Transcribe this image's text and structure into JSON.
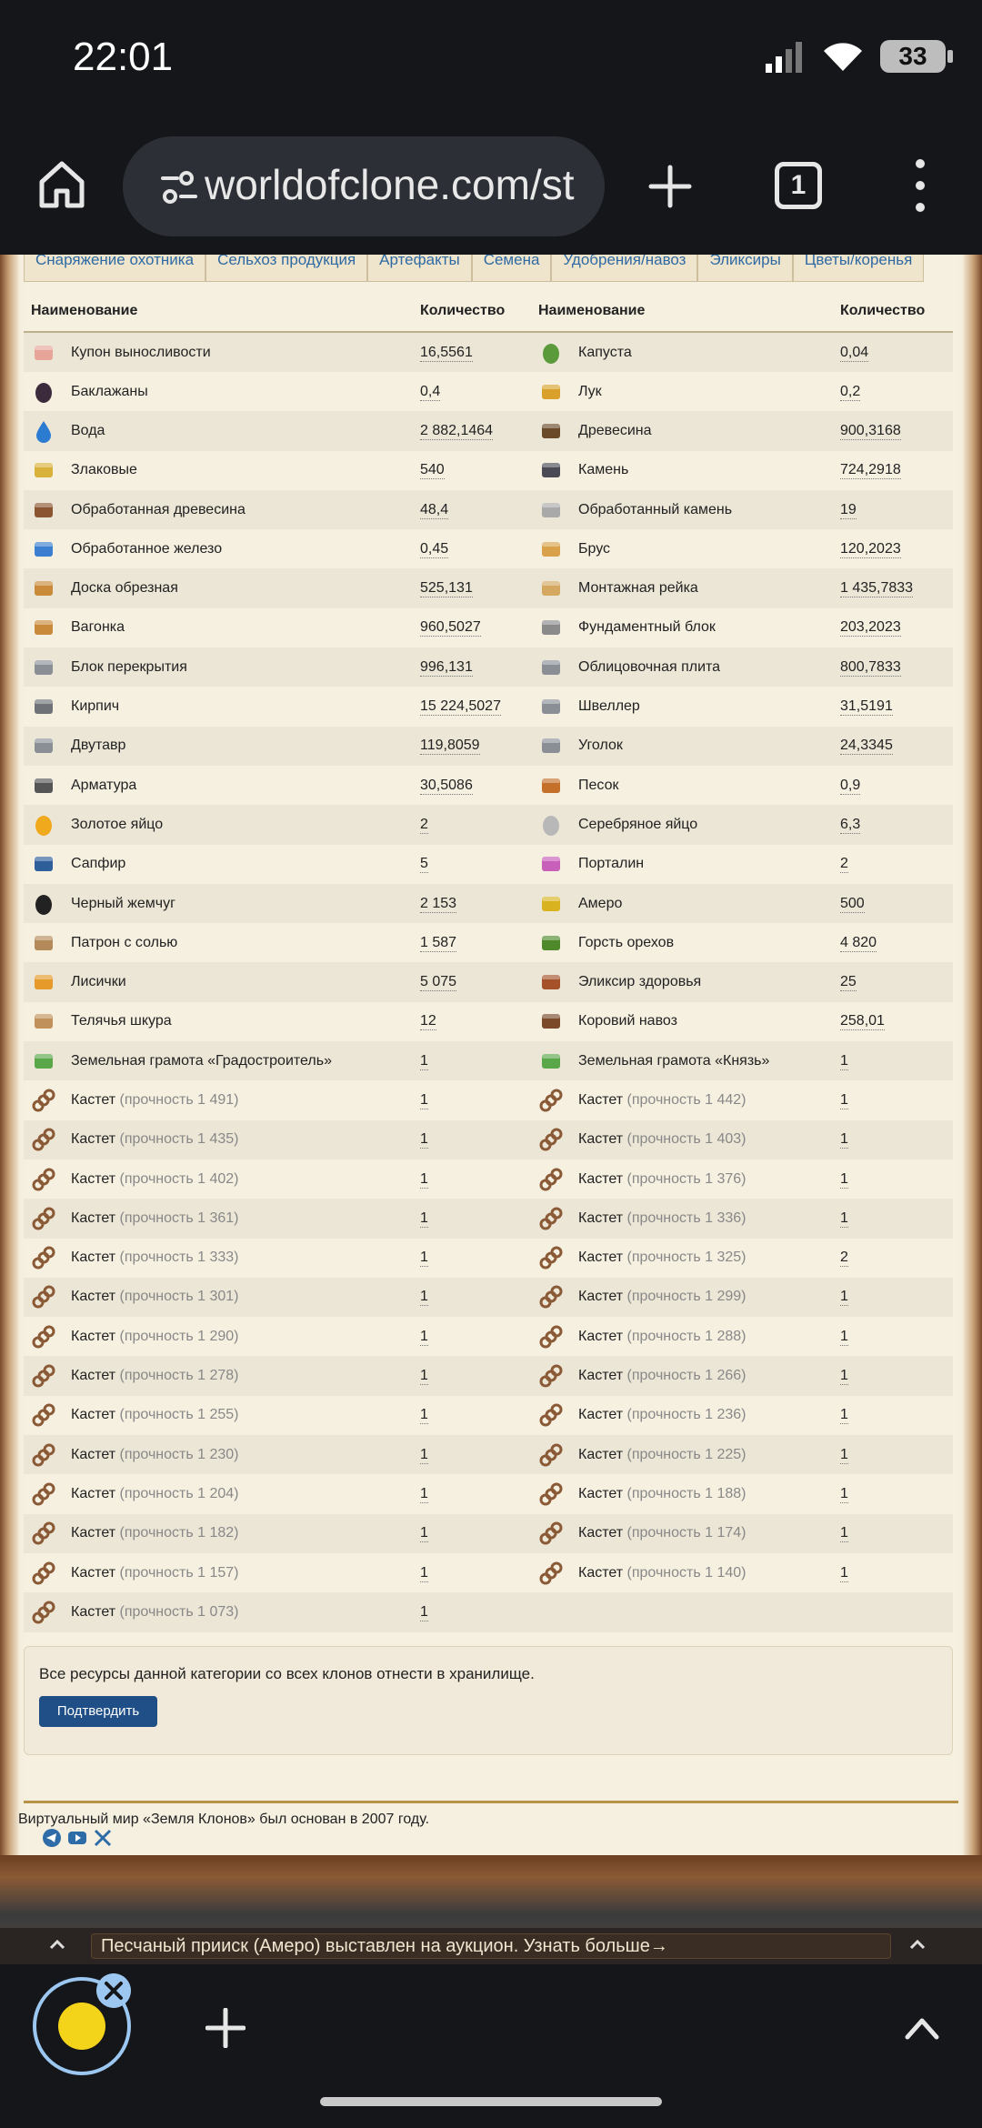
{
  "status": {
    "time": "22:01",
    "battery": "33"
  },
  "browser": {
    "url": "worldofclone.com/st",
    "tab_count": "1"
  },
  "subtabs": [
    "Снаряжение охотника",
    "Сельхоз продукция",
    "Артефакты",
    "Семена",
    "Удобрения/навоз",
    "Эликсиры",
    "Цветы/коренья"
  ],
  "table": {
    "headers": {
      "name": "Наименование",
      "qty": "Количество"
    },
    "rows": [
      {
        "l": {
          "icon": "coupon-icon",
          "name": "Купон выносливости",
          "qty": "16,5561"
        },
        "r": {
          "icon": "cabbage-icon",
          "name": "Капуста",
          "qty": "0,04"
        }
      },
      {
        "l": {
          "icon": "eggplant-icon",
          "name": "Баклажаны",
          "qty": "0,4"
        },
        "r": {
          "icon": "onion-icon",
          "name": "Лук",
          "qty": "0,2"
        }
      },
      {
        "l": {
          "icon": "water-drop-icon",
          "name": "Вода",
          "qty": "2 882,1464"
        },
        "r": {
          "icon": "wood-icon",
          "name": "Древесина",
          "qty": "900,3168"
        }
      },
      {
        "l": {
          "icon": "grain-icon",
          "name": "Злаковые",
          "qty": "540"
        },
        "r": {
          "icon": "stone-icon",
          "name": "Камень",
          "qty": "724,2918"
        }
      },
      {
        "l": {
          "icon": "processed-wood-icon",
          "name": "Обработанная древесина",
          "qty": "48,4"
        },
        "r": {
          "icon": "processed-stone-icon",
          "name": "Обработанный камень",
          "qty": "19"
        }
      },
      {
        "l": {
          "icon": "processed-iron-icon",
          "name": "Обработанное железо",
          "qty": "0,45"
        },
        "r": {
          "icon": "beam-icon",
          "name": "Брус",
          "qty": "120,2023"
        }
      },
      {
        "l": {
          "icon": "board-icon",
          "name": "Доска обрезная",
          "qty": "525,131"
        },
        "r": {
          "icon": "rail-icon",
          "name": "Монтажная рейка",
          "qty": "1 435,7833"
        }
      },
      {
        "l": {
          "icon": "lining-icon",
          "name": "Вагонка",
          "qty": "960,5027"
        },
        "r": {
          "icon": "foundation-block-icon",
          "name": "Фундаментный блок",
          "qty": "203,2023"
        }
      },
      {
        "l": {
          "icon": "floor-block-icon",
          "name": "Блок перекрытия",
          "qty": "996,131"
        },
        "r": {
          "icon": "facing-slab-icon",
          "name": "Облицовочная плита",
          "qty": "800,7833"
        }
      },
      {
        "l": {
          "icon": "brick-icon",
          "name": "Кирпич",
          "qty": "15 224,5027"
        },
        "r": {
          "icon": "channel-icon",
          "name": "Швеллер",
          "qty": "31,5191"
        }
      },
      {
        "l": {
          "icon": "i-beam-icon",
          "name": "Двутавр",
          "qty": "119,8059"
        },
        "r": {
          "icon": "angle-icon",
          "name": "Уголок",
          "qty": "24,3345"
        }
      },
      {
        "l": {
          "icon": "rebar-icon",
          "name": "Арматура",
          "qty": "30,5086"
        },
        "r": {
          "icon": "sand-icon",
          "name": "Песок",
          "qty": "0,9"
        }
      },
      {
        "l": {
          "icon": "golden-egg-icon",
          "name": "Золотое яйцо",
          "qty": "2"
        },
        "r": {
          "icon": "silver-egg-icon",
          "name": "Серебряное яйцо",
          "qty": "6,3"
        }
      },
      {
        "l": {
          "icon": "sapphire-icon",
          "name": "Сапфир",
          "qty": "5"
        },
        "r": {
          "icon": "portalin-icon",
          "name": "Порталин",
          "qty": "2"
        }
      },
      {
        "l": {
          "icon": "black-pearl-icon",
          "name": "Черный жемчуг",
          "qty": "2 153"
        },
        "r": {
          "icon": "amero-icon",
          "name": "Амеро",
          "qty": "500"
        }
      },
      {
        "l": {
          "icon": "salt-cartridge-icon",
          "name": "Патрон с солью",
          "qty": "1 587"
        },
        "r": {
          "icon": "nuts-icon",
          "name": "Горсть орехов",
          "qty": "4 820"
        }
      },
      {
        "l": {
          "icon": "chanterelle-icon",
          "name": "Лисички",
          "qty": "5 075"
        },
        "r": {
          "icon": "health-elixir-icon",
          "name": "Эликсир здоровья",
          "qty": "25"
        }
      },
      {
        "l": {
          "icon": "calf-skin-icon",
          "name": "Телячья шкура",
          "qty": "12"
        },
        "r": {
          "icon": "manure-icon",
          "name": "Коровий навоз",
          "qty": "258,01"
        }
      },
      {
        "l": {
          "icon": "land-charter-icon",
          "name": "Земельная грамота «Градостроитель»",
          "qty": "1"
        },
        "r": {
          "icon": "land-charter-icon",
          "name": "Земельная грамота «Князь»",
          "qty": "1"
        }
      },
      {
        "l": {
          "icon": "knuckles-icon",
          "name": "Кастет",
          "dur": "(прочность 1 491)",
          "qty": "1"
        },
        "r": {
          "icon": "knuckles-icon",
          "name": "Кастет",
          "dur": "(прочность 1 442)",
          "qty": "1"
        }
      },
      {
        "l": {
          "icon": "knuckles-icon",
          "name": "Кастет",
          "dur": "(прочность 1 435)",
          "qty": "1"
        },
        "r": {
          "icon": "knuckles-icon",
          "name": "Кастет",
          "dur": "(прочность 1 403)",
          "qty": "1"
        }
      },
      {
        "l": {
          "icon": "knuckles-icon",
          "name": "Кастет",
          "dur": "(прочность 1 402)",
          "qty": "1"
        },
        "r": {
          "icon": "knuckles-icon",
          "name": "Кастет",
          "dur": "(прочность 1 376)",
          "qty": "1"
        }
      },
      {
        "l": {
          "icon": "knuckles-icon",
          "name": "Кастет",
          "dur": "(прочность 1 361)",
          "qty": "1"
        },
        "r": {
          "icon": "knuckles-icon",
          "name": "Кастет",
          "dur": "(прочность 1 336)",
          "qty": "1"
        }
      },
      {
        "l": {
          "icon": "knuckles-icon",
          "name": "Кастет",
          "dur": "(прочность 1 333)",
          "qty": "1"
        },
        "r": {
          "icon": "knuckles-icon",
          "name": "Кастет",
          "dur": "(прочность 1 325)",
          "qty": "2"
        }
      },
      {
        "l": {
          "icon": "knuckles-icon",
          "name": "Кастет",
          "dur": "(прочность 1 301)",
          "qty": "1"
        },
        "r": {
          "icon": "knuckles-icon",
          "name": "Кастет",
          "dur": "(прочность 1 299)",
          "qty": "1"
        }
      },
      {
        "l": {
          "icon": "knuckles-icon",
          "name": "Кастет",
          "dur": "(прочность 1 290)",
          "qty": "1"
        },
        "r": {
          "icon": "knuckles-icon",
          "name": "Кастет",
          "dur": "(прочность 1 288)",
          "qty": "1"
        }
      },
      {
        "l": {
          "icon": "knuckles-icon",
          "name": "Кастет",
          "dur": "(прочность 1 278)",
          "qty": "1"
        },
        "r": {
          "icon": "knuckles-icon",
          "name": "Кастет",
          "dur": "(прочность 1 266)",
          "qty": "1"
        }
      },
      {
        "l": {
          "icon": "knuckles-icon",
          "name": "Кастет",
          "dur": "(прочность 1 255)",
          "qty": "1"
        },
        "r": {
          "icon": "knuckles-icon",
          "name": "Кастет",
          "dur": "(прочность 1 236)",
          "qty": "1"
        }
      },
      {
        "l": {
          "icon": "knuckles-icon",
          "name": "Кастет",
          "dur": "(прочность 1 230)",
          "qty": "1"
        },
        "r": {
          "icon": "knuckles-icon",
          "name": "Кастет",
          "dur": "(прочность 1 225)",
          "qty": "1"
        }
      },
      {
        "l": {
          "icon": "knuckles-icon",
          "name": "Кастет",
          "dur": "(прочность 1 204)",
          "qty": "1"
        },
        "r": {
          "icon": "knuckles-icon",
          "name": "Кастет",
          "dur": "(прочность 1 188)",
          "qty": "1"
        }
      },
      {
        "l": {
          "icon": "knuckles-icon",
          "name": "Кастет",
          "dur": "(прочность 1 182)",
          "qty": "1"
        },
        "r": {
          "icon": "knuckles-icon",
          "name": "Кастет",
          "dur": "(прочность 1 174)",
          "qty": "1"
        }
      },
      {
        "l": {
          "icon": "knuckles-icon",
          "name": "Кастет",
          "dur": "(прочность 1 157)",
          "qty": "1"
        },
        "r": {
          "icon": "knuckles-icon",
          "name": "Кастет",
          "dur": "(прочность 1 140)",
          "qty": "1"
        }
      },
      {
        "l": {
          "icon": "knuckles-icon",
          "name": "Кастет",
          "dur": "(прочность 1 073)",
          "qty": "1"
        },
        "r": null
      }
    ]
  },
  "notice": {
    "text": "Все ресурсы данной категории со всех клонов отнести в хранилище.",
    "button": "Подтвердить"
  },
  "footer": {
    "text": "Виртуальный мир «Земля Клонов» был основан в 2007 году."
  },
  "news_ticker": "Песчаный прииск (Амеро) выставлен на аукцион. Узнать больше→"
}
